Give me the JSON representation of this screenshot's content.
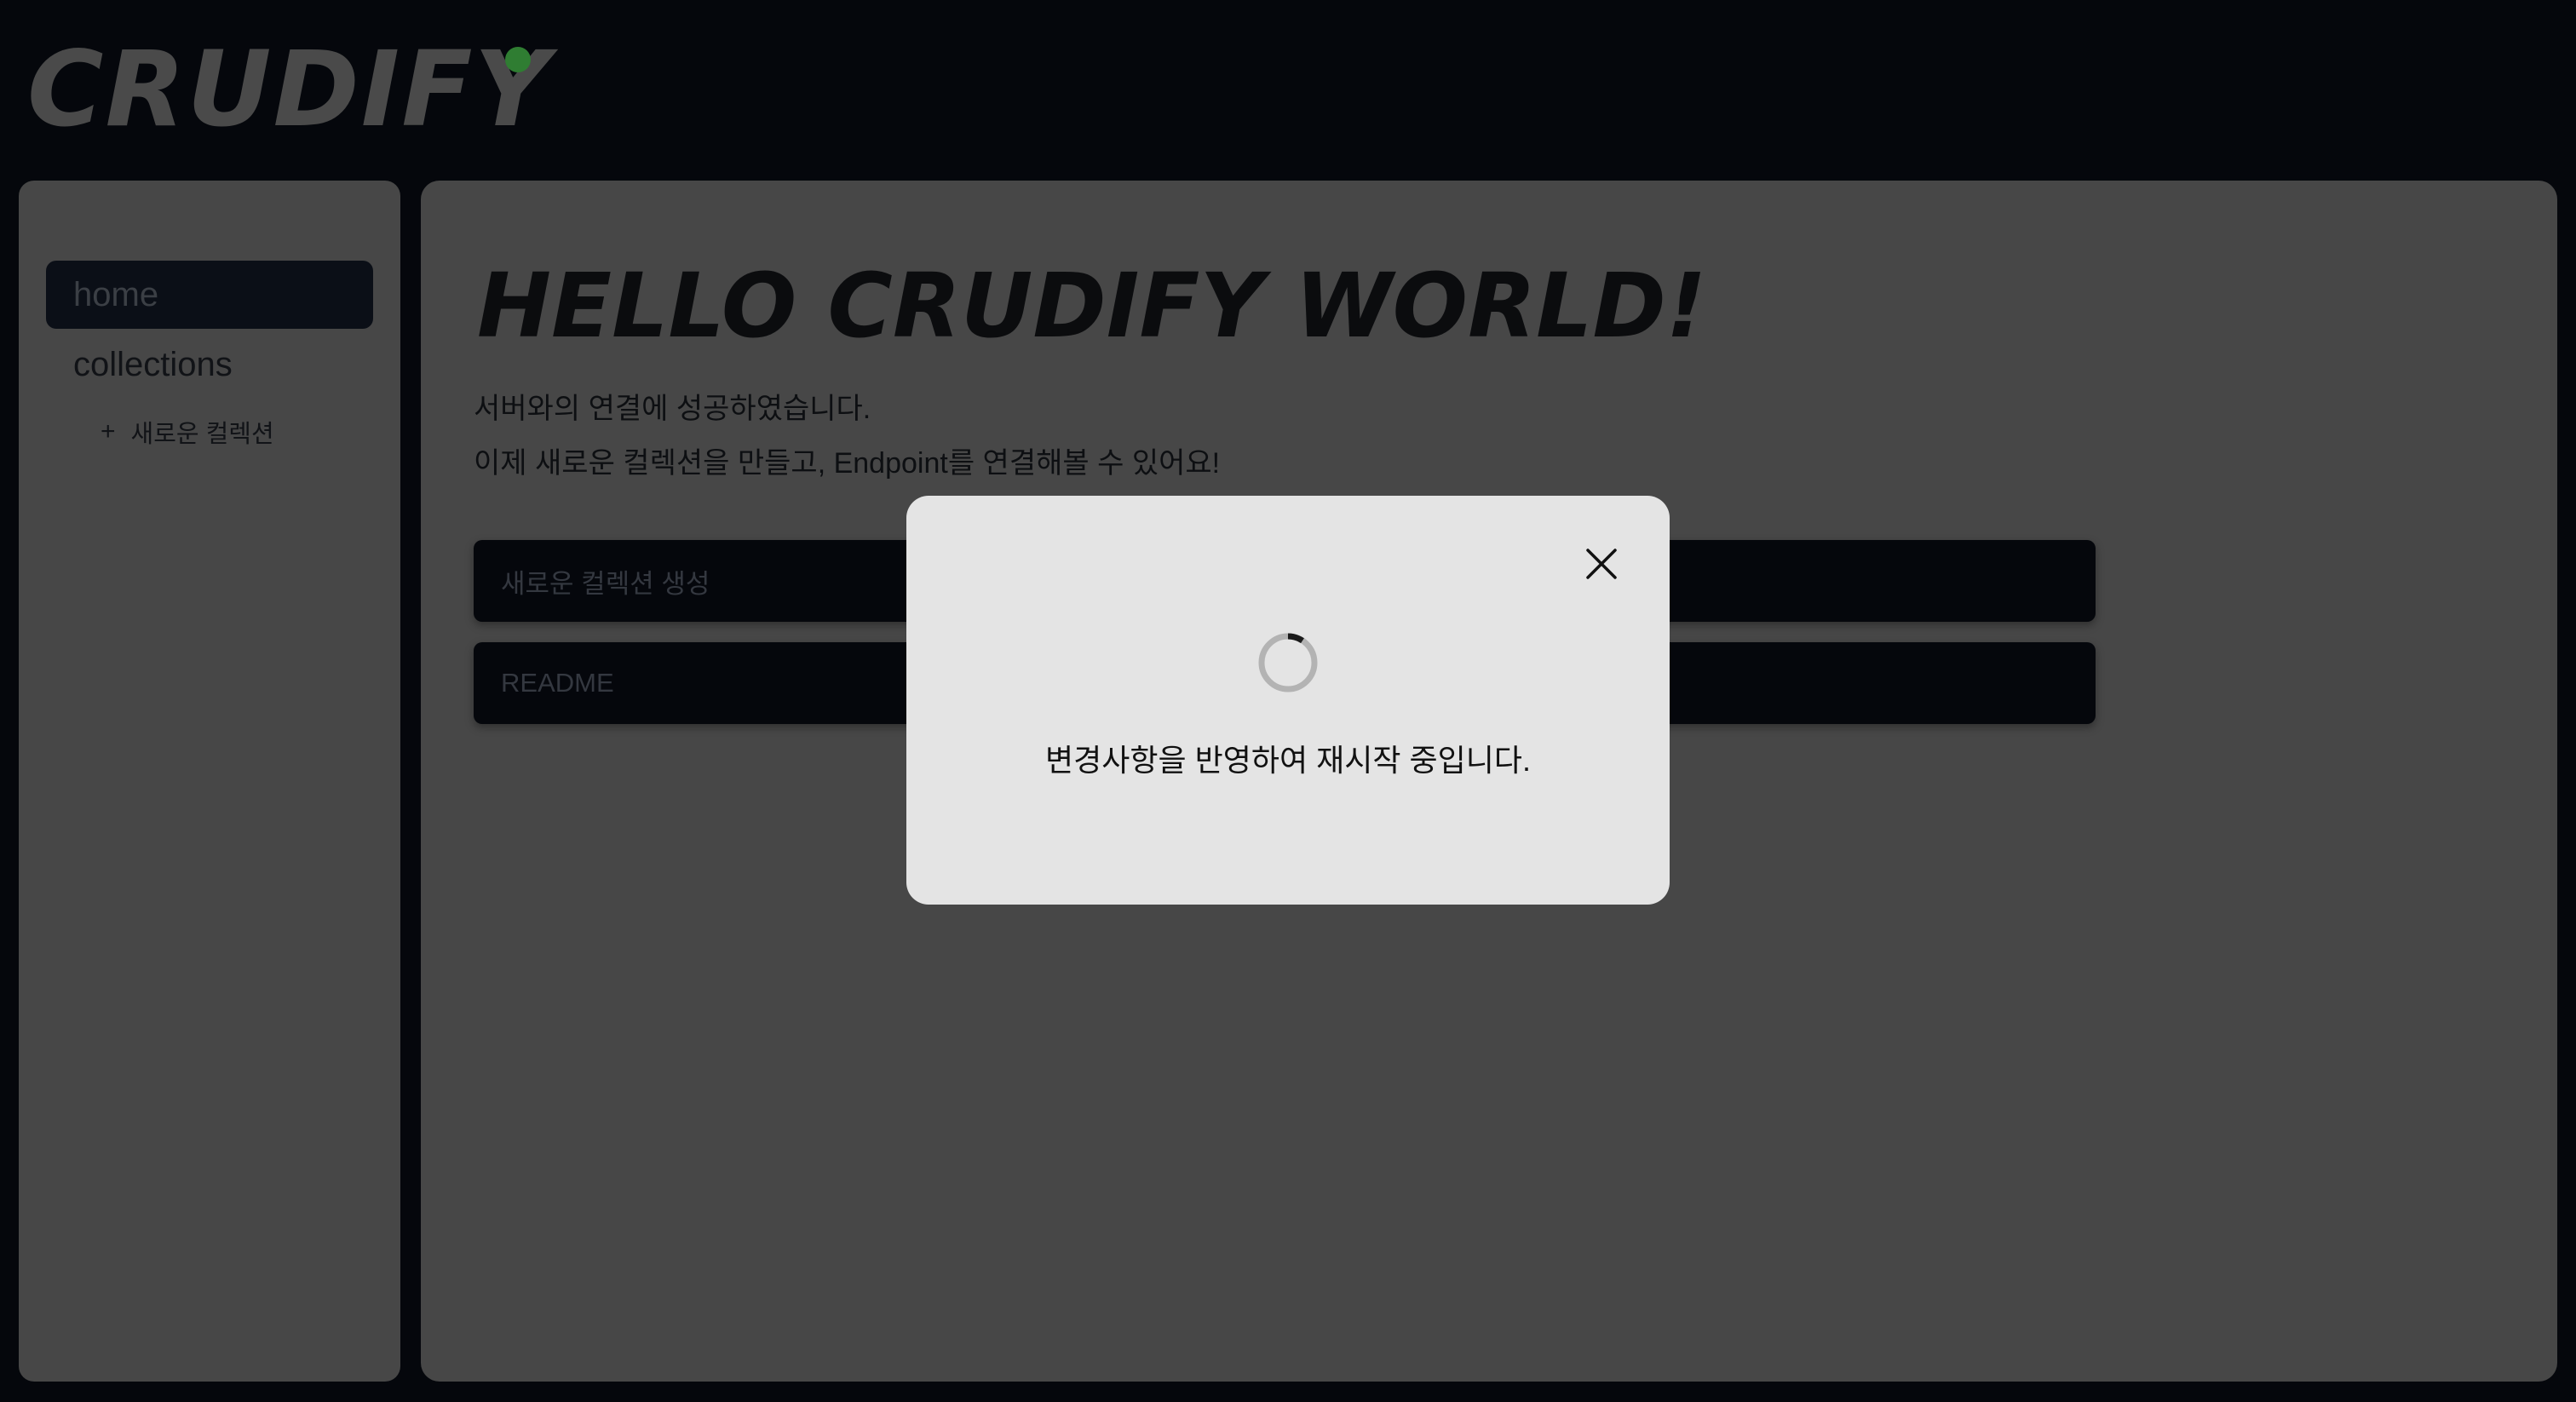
{
  "header": {
    "logo": "CRUDIFY",
    "status_color": "#2f7d32"
  },
  "sidebar": {
    "items": [
      {
        "label": "home",
        "active": true
      },
      {
        "label": "collections",
        "active": false
      }
    ],
    "sub_action": {
      "icon": "plus-icon",
      "label": "새로운 컬렉션"
    }
  },
  "main": {
    "title": "HELLO CRUDIFY WORLD!",
    "description_line1": "서버와의 연결에 성공하였습니다.",
    "description_line2": "이제 새로운 컬렉션을 만들고, Endpoint를 연결해볼 수 있어요!",
    "actions": [
      {
        "label": "새로운 컬렉션 생성"
      },
      {
        "label": "README"
      }
    ]
  },
  "modal": {
    "message": "변경사항을 반영하여 재시작 중입니다.",
    "icons": [
      "close-icon",
      "loading-spinner-icon"
    ]
  }
}
